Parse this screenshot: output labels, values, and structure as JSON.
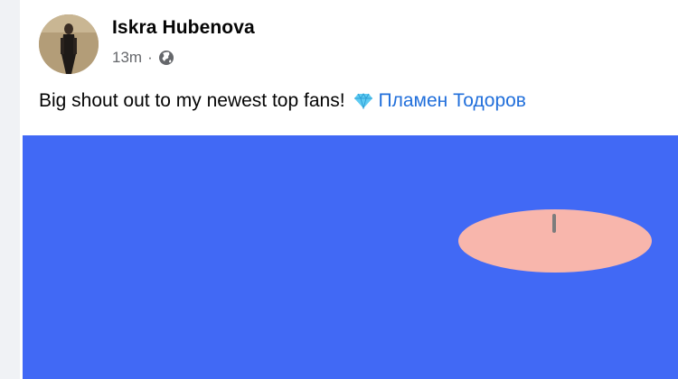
{
  "post": {
    "author": "Iskra Hubenova",
    "time": "13m",
    "separator": "·",
    "privacy_icon": "globe-icon",
    "text": "Big shout out to my newest top fans!",
    "badge_icon": "diamond-icon",
    "tagged_name": "Пламен Тодоров"
  },
  "colors": {
    "media_background": "#4169f5",
    "link": "#216fdb",
    "shape": "#f8b6ac"
  }
}
